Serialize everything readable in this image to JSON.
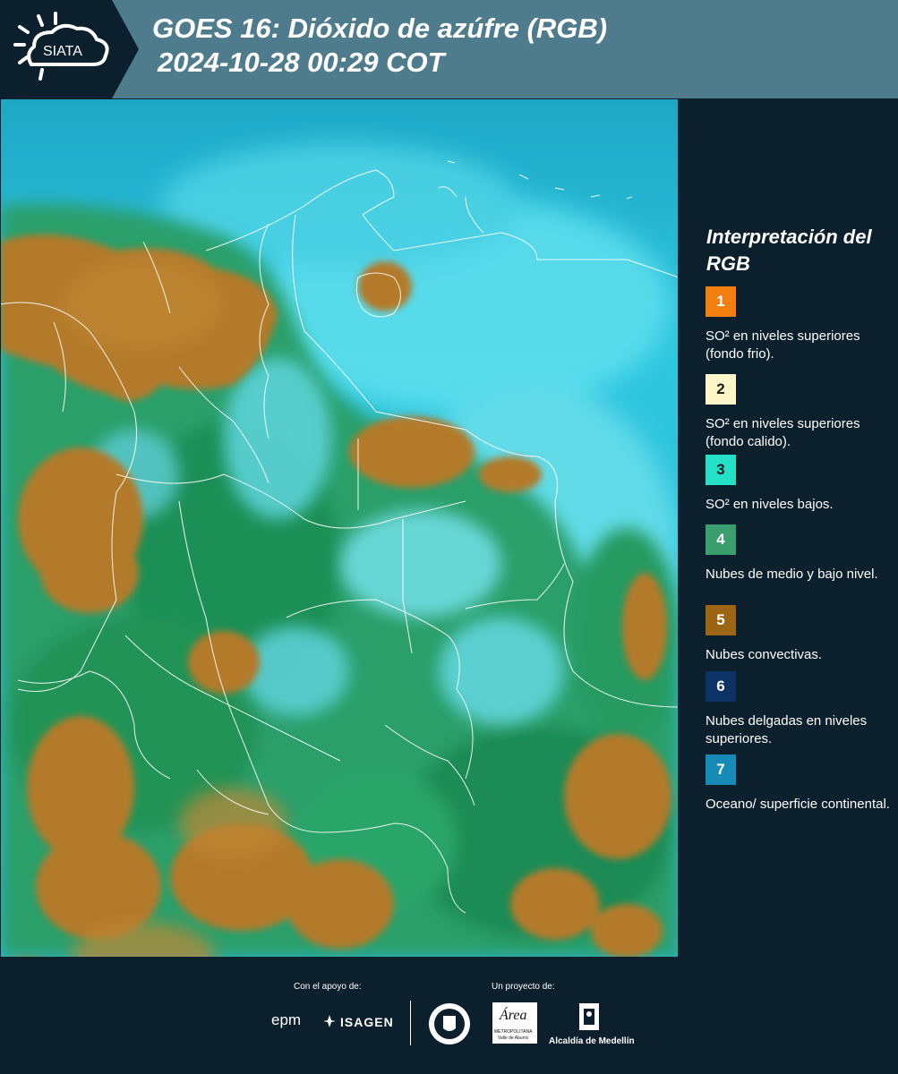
{
  "header": {
    "logo_text": "SIATA",
    "title_line1": "GOES 16: Dióxido de azúfre (RGB)",
    "title_line2": "2024-10-28 00:29 COT"
  },
  "map": {
    "icon": "satellite-map-image"
  },
  "legend": {
    "title": "Interpretación del RGB",
    "items": [
      {
        "number": "1",
        "color": "#f27f10",
        "text_color": "#ffffff",
        "label": "SO² en niveles superiores (fondo frio)."
      },
      {
        "number": "2",
        "color": "#fdf6c8",
        "text_color": "#1a1a1a",
        "label": "SO² en niveles superiores (fondo calido)."
      },
      {
        "number": "3",
        "color": "#23e0c6",
        "text_color": "#1a1a1a",
        "label": "SO² en niveles bajos."
      },
      {
        "number": "4",
        "color": "#3a9e6e",
        "text_color": "#ffffff",
        "label": "Nubes de medio y bajo nivel."
      },
      {
        "number": "5",
        "color": "#9c6514",
        "text_color": "#ffffff",
        "label": "Nubes convectivas."
      },
      {
        "number": "6",
        "color": "#0d3266",
        "text_color": "#ffffff",
        "label": "Nubes delgadas en niveles superiores."
      },
      {
        "number": "7",
        "color": "#178bb7",
        "text_color": "#ffffff",
        "label": "Oceano/ superficie continental."
      }
    ]
  },
  "footer": {
    "support_label": "Con el apoyo de:",
    "project_label": "Un proyecto de:",
    "epm": "epm",
    "isagen": "ISAGEN",
    "area_label": "Área",
    "area_sub": "METROPOLITANA",
    "area_sub2": "Valle de Aburrá",
    "alcaldia": "Alcaldía de Medellín"
  }
}
